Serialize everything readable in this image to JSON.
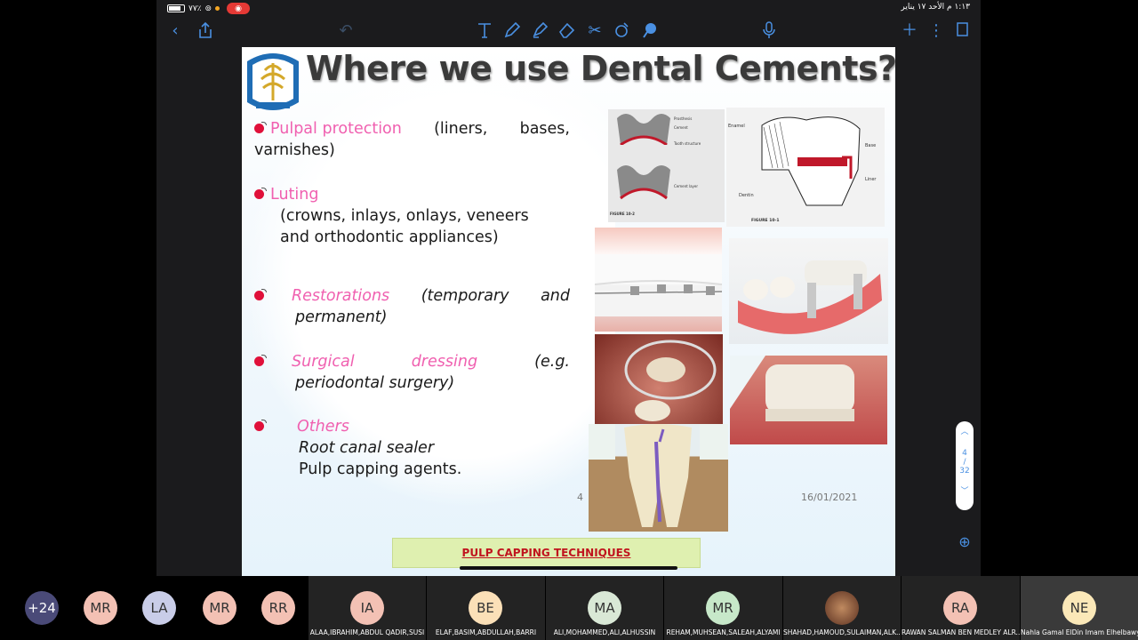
{
  "status_bar": {
    "battery": "٧٧٪",
    "time_date": "١:١٣ م  الأحد ١٧ يناير"
  },
  "toolbar": {
    "icons": [
      "back-chevron-icon",
      "share-icon",
      "undo-icon",
      "text-tool-icon",
      "pen-icon",
      "highlighter-icon",
      "eraser-icon",
      "scissors-icon",
      "shapes-icon",
      "lasso-icon",
      "microphone-icon",
      "add-icon",
      "more-icon",
      "pages-icon"
    ],
    "accent": "#4a90e2"
  },
  "slide": {
    "title": "Where we use Dental Cements?",
    "bullets": [
      {
        "head": "Pulpal protection",
        "tail_1": "(liners,",
        "tail_2": "bases,",
        "tail_3": "varnishes)"
      },
      {
        "head": "Luting",
        "line_1": "(crowns, inlays, onlays, veneers",
        "line_2": "and orthodontic appliances)"
      },
      {
        "head": "Restorations",
        "w1": "(temporary",
        "w2": "and",
        "line_2": "permanent)"
      },
      {
        "head_1": "Surgical",
        "head_2": "dressing",
        "w1": "(e.g.",
        "line_2": "periodontal surgery)"
      },
      {
        "head": "Others",
        "line_1": "Root canal sealer",
        "line_2": "Pulp capping  agents."
      }
    ],
    "page_number": "4",
    "date": "16/01/2021",
    "link_label": "PULP CAPPING TECHNIQUES",
    "figure_labels": {
      "fig1": [
        "Prosthesis",
        "Cement",
        "Tooth structure",
        "Cement layer",
        "FIGURE 10-2"
      ],
      "fig2": [
        "Enamel",
        "Base",
        "Dentin",
        "Liner",
        "FIGURE 10-1"
      ]
    }
  },
  "pager": {
    "current": "4",
    "total": "32"
  },
  "participants": [
    {
      "initials": "+24",
      "color": "#4a4a78",
      "name": ""
    },
    {
      "initials": "MR",
      "color": "#f3c1b4",
      "name": ""
    },
    {
      "initials": "LA",
      "color": "#c9cde8",
      "name": ""
    },
    {
      "initials": "MR",
      "color": "#f3c1b4",
      "name": ""
    },
    {
      "initials": "RR",
      "color": "#f3c1b4",
      "name": ""
    },
    {
      "initials": "IA",
      "color": "#f3c1b4",
      "name": "ALAA,IBRAHIM,ABDUL QADIR,SUSI"
    },
    {
      "initials": "BE",
      "color": "#fbe0b8",
      "name": "ELAF,BASIM,ABDULLAH,BARRI"
    },
    {
      "initials": "MA",
      "color": "#d9e8d6",
      "name": "ALI,MOHAMMED,ALI,ALHUSSIN"
    },
    {
      "initials": "MR",
      "color": "#c7e8c9",
      "name": "REHAM,MUHSEAN,SALEAH,ALYAMI"
    },
    {
      "initials": "",
      "color": "#8a5a3a",
      "name": "SHAHAD,HAMOUD,SULAIMAN,ALK..."
    },
    {
      "initials": "RA",
      "color": "#f3c1b4",
      "name": "RAWAN SALMAN BEN MEDLEY ALR..."
    },
    {
      "initials": "NE",
      "color": "#fbe8b8",
      "name": "Nahla Gamal ElDin Imam Elhelbawy"
    }
  ]
}
